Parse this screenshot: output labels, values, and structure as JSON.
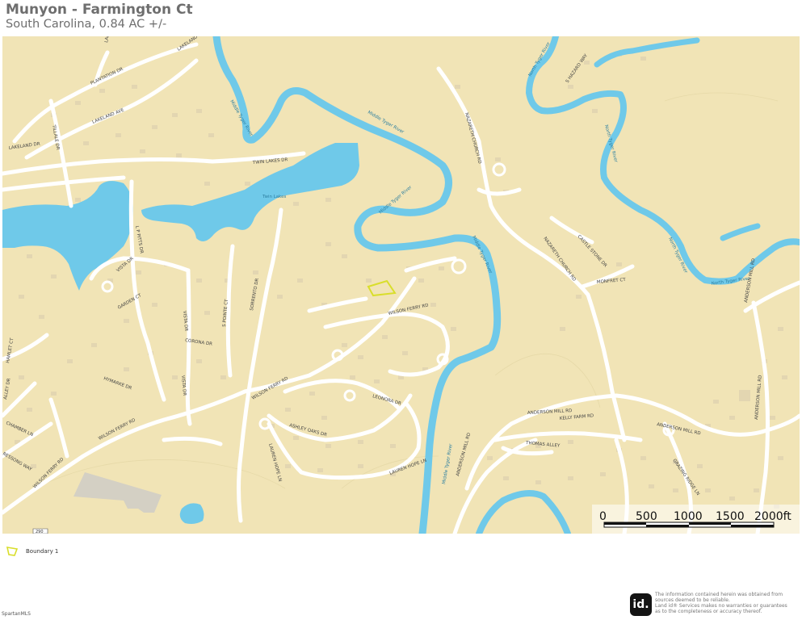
{
  "header": {
    "title": "Munyon - Farmington Ct",
    "subtitle": "South Carolina, 0.84 AC +/-"
  },
  "colors": {
    "land": "#f1e4b6",
    "water": "#6fc9e9",
    "road": "#ffffff",
    "building": "#e3d6b1",
    "boundary": "#d9de2b",
    "industrial": "#d4d0c4"
  },
  "map": {
    "streets": {
      "plantation_dr": "PLANTATION DR",
      "lakeland_ave_top": "LAKELAND AVE",
      "lakeland_ave": "LAKELAND AVE",
      "lakeland_ave_w": "LAKELAND AVE",
      "tillale_dr": "TILLALE DR",
      "twin_lakes_dr": "TWIN LAKES DR",
      "lakeland_dr": "LAKELAND DR",
      "l_p_pitts_dr": "L P PITTS DR",
      "vista_dr_n": "VISTA DR",
      "garden_ct": "GARDEN CT",
      "corona_dr": "CORONA DR",
      "s_pointe_ct": "S POINTE CT",
      "sorrento_dr": "SORRENTO DR",
      "vista_dr_mid": "VISTA DR",
      "vista_dr_s": "VISTA DR",
      "hymarke_dr": "HYMARKE DR",
      "hamlet_ct": "HAMLET CT",
      "alley_dr": "ALLEY DR",
      "chamber_ln": "CHAMBER LN",
      "wilson_ferry_rd_w": "WILSON FERRY RD",
      "wilson_ferry_rd_sw": "WILSON FERRY RD",
      "wilson_ferry_rd_mid": "WILSON FERRY RD",
      "wilson_ferry_rd_e": "WILSON FERRY RD",
      "ashley_oaks_dr": "ASHLEY OAKS DR",
      "lauren_hope_ln": "LAUREN HOPE LN",
      "lauren_hope_ln_e": "LAUREN HOPE LN",
      "leonora_dr": "LEONORA DR",
      "nazareth_church_rd_n": "NAZARETH CHURCH RD",
      "nazareth_church_rd_s": "NAZARETH CHURCH RD",
      "castle_stone_dr": "CASTLE STONE DR",
      "monfret_ct": "MONFRET CT",
      "hazard_way": "S HAZARD WAY",
      "anderson_mill_rd_n": "ANDERSON MILL RD",
      "anderson_mill_rd_mid": "ANDERSON MILL RD",
      "anderson_mill_rd_e": "ANDERSON MILL RD",
      "anderson_mill_rd_sw": "ANDERSON MILL RD",
      "anderson_mill_rd_se": "ANDERSON MILL RD",
      "kelly_farm_rd": "KELLY FARM RD",
      "thomas_alley": "THOMAS ALLEY",
      "grazing_ridge_ln": "GRAZING RIDGE LN",
      "ressong_way": "RESSONG WAY",
      "route_shield": "290"
    },
    "water": {
      "twin_lakes": "Twin Lakes",
      "middle_tyger_1": "Middle Tyger River",
      "middle_tyger_2": "Middle Tyger River",
      "middle_tyger_3": "Middle Tyger River",
      "middle_tyger_4": "Middle Tyger River",
      "middle_tyger_5": "Middle Tyger River",
      "north_tyger_1": "North Tyger River",
      "north_tyger_2": "North Tyger River",
      "north_tyger_3": "North Tyger River",
      "north_tyger_4": "North Tyger River"
    },
    "scale_bar": {
      "labels": [
        "0",
        "500",
        "1000",
        "1500",
        "2000ft"
      ]
    }
  },
  "legend": {
    "boundary_label": "Boundary 1"
  },
  "footer": {
    "logo_text": "id.",
    "disclaimer_lines": [
      "The information contained herein was obtained from",
      "sources deemed to be reliable.",
      "Land id® Services makes no warranties or guarantees",
      "as to the completeness or accuracy thereof."
    ],
    "mls_text": "SpartanMLS"
  }
}
